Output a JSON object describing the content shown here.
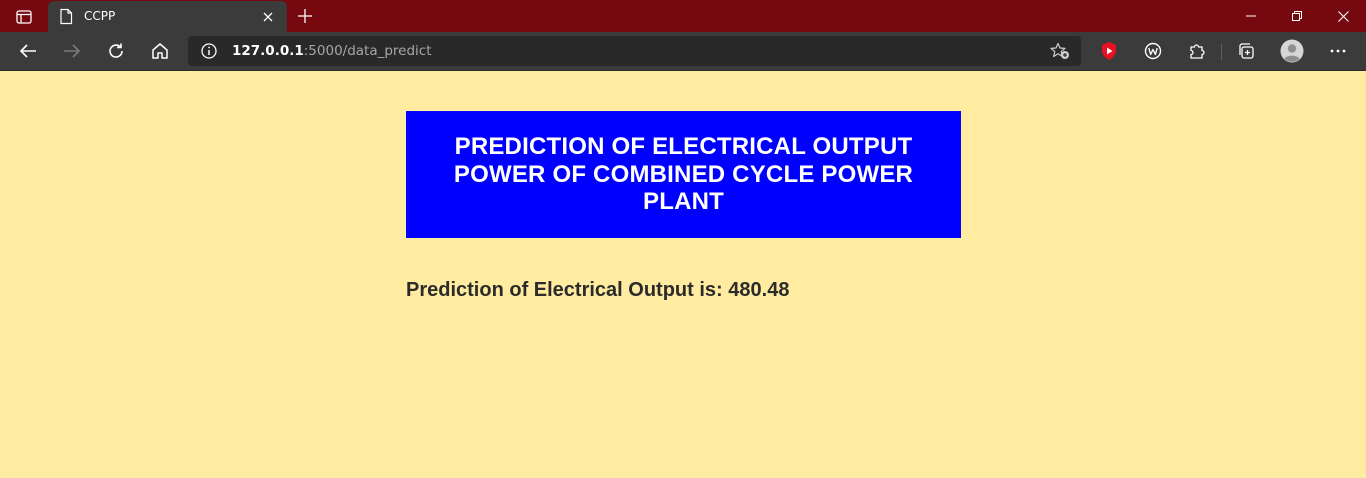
{
  "browser": {
    "tab": {
      "title": "CCPP",
      "favicon": "page-icon"
    },
    "address_bar": {
      "host": "127.0.0.1",
      "path": ":5000/data_predict"
    },
    "window_controls": [
      "minimize-icon",
      "restore-icon",
      "close-icon"
    ],
    "frame_color": "#760810"
  },
  "page": {
    "background": "#ffeca1",
    "header": {
      "title": "PREDICTION OF ELECTRICAL OUTPUT POWER OF COMBINED CYCLE POWER PLANT",
      "background": "#0000ff"
    },
    "result": {
      "text": "Prediction of Electrical Output is: 480.48"
    }
  }
}
